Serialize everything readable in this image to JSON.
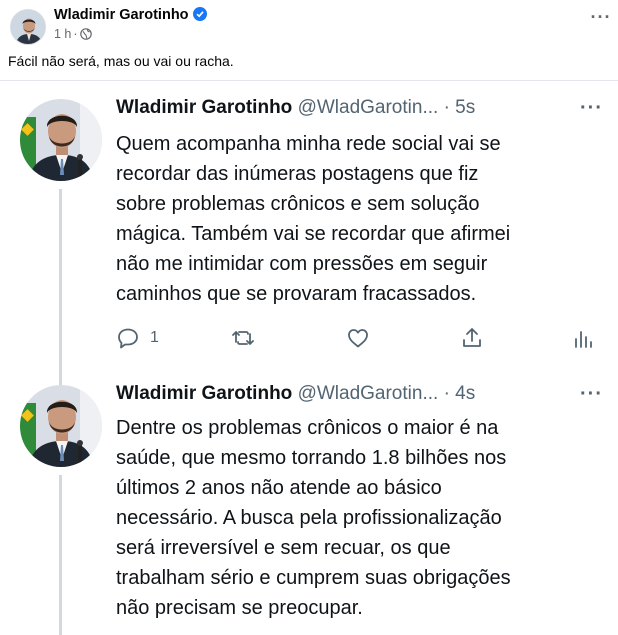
{
  "facebook_post": {
    "author": "Wladimir Garotinho",
    "time": "1 h",
    "separator": "·",
    "caption": "Fácil não será, mas ou vai ou racha."
  },
  "tweets": [
    {
      "name": "Wladimir Garotinho",
      "handle": "@WladGarotin...",
      "time": "· 5s",
      "lines": [
        "Quem acompanha minha rede social vai se",
        "recordar das inúmeras postagens que fiz",
        "sobre problemas crônicos e sem solução",
        "mágica. Também vai se recordar que afirmei",
        "não me intimidar com pressões em seguir",
        "caminhos que se provaram fracassados."
      ],
      "reply_count": "1"
    },
    {
      "name": "Wladimir Garotinho",
      "handle": "@WladGarotin...",
      "time": "· 4s",
      "lines": [
        "Dentre os problemas crônicos o maior é na",
        "saúde, que mesmo torrando 1.8 bilhões nos",
        "últimos 2 anos não atende ao básico",
        "necessário. A busca pela profissionalização",
        "será irreversível e sem recuar, os que",
        "trabalham sério e cumprem suas obrigações",
        "não precisam se preocupar."
      ]
    }
  ],
  "colors": {
    "fb_text": "#050505",
    "fb_meta": "#65676b",
    "verified": "#1877f2",
    "tw_text": "#0f1419",
    "tw_secondary": "#536471",
    "thread_line": "#cfd9de"
  }
}
